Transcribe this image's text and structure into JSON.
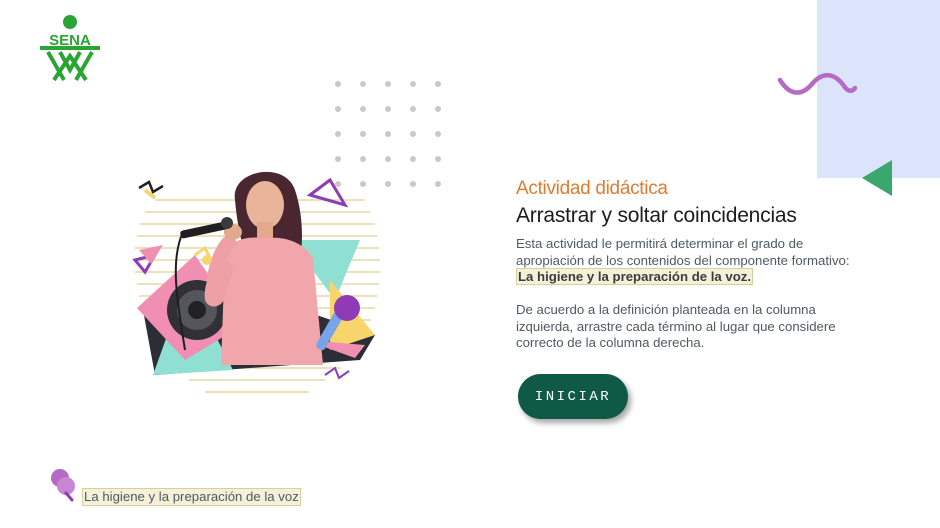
{
  "logo": {
    "text": "SENA",
    "color": "#2aa534"
  },
  "header": {
    "subtitle": "Actividad didáctica",
    "title": "Arrastrar y soltar coincidencias"
  },
  "description": {
    "p1_text": "Esta actividad le permitirá determinar el grado de apropiación de los contenidos del componente formativo: ",
    "p1_highlight": "La higiene y la preparación de la voz.",
    "p2_text": "De acuerdo a la definición planteada en la columna izquierda, arrastre cada término al lugar que considere correcto de la columna derecha."
  },
  "actions": {
    "start_label": "INICIAR"
  },
  "footer": {
    "label": "La higiene y la preparación de la voz"
  },
  "colors": {
    "accent": "#e07b2f",
    "button": "#0f5a46",
    "brand": "#2aa534",
    "decor_purple": "#b56bc6",
    "decor_green": "#3aa76d",
    "panel_blue": "#dbe4fb"
  },
  "icons": {
    "logo": "sena-logo",
    "wave": "wave-decoration",
    "triangle": "triangle-decoration",
    "pin": "microphone-pin-icon",
    "illustration": "singer-illustration"
  }
}
